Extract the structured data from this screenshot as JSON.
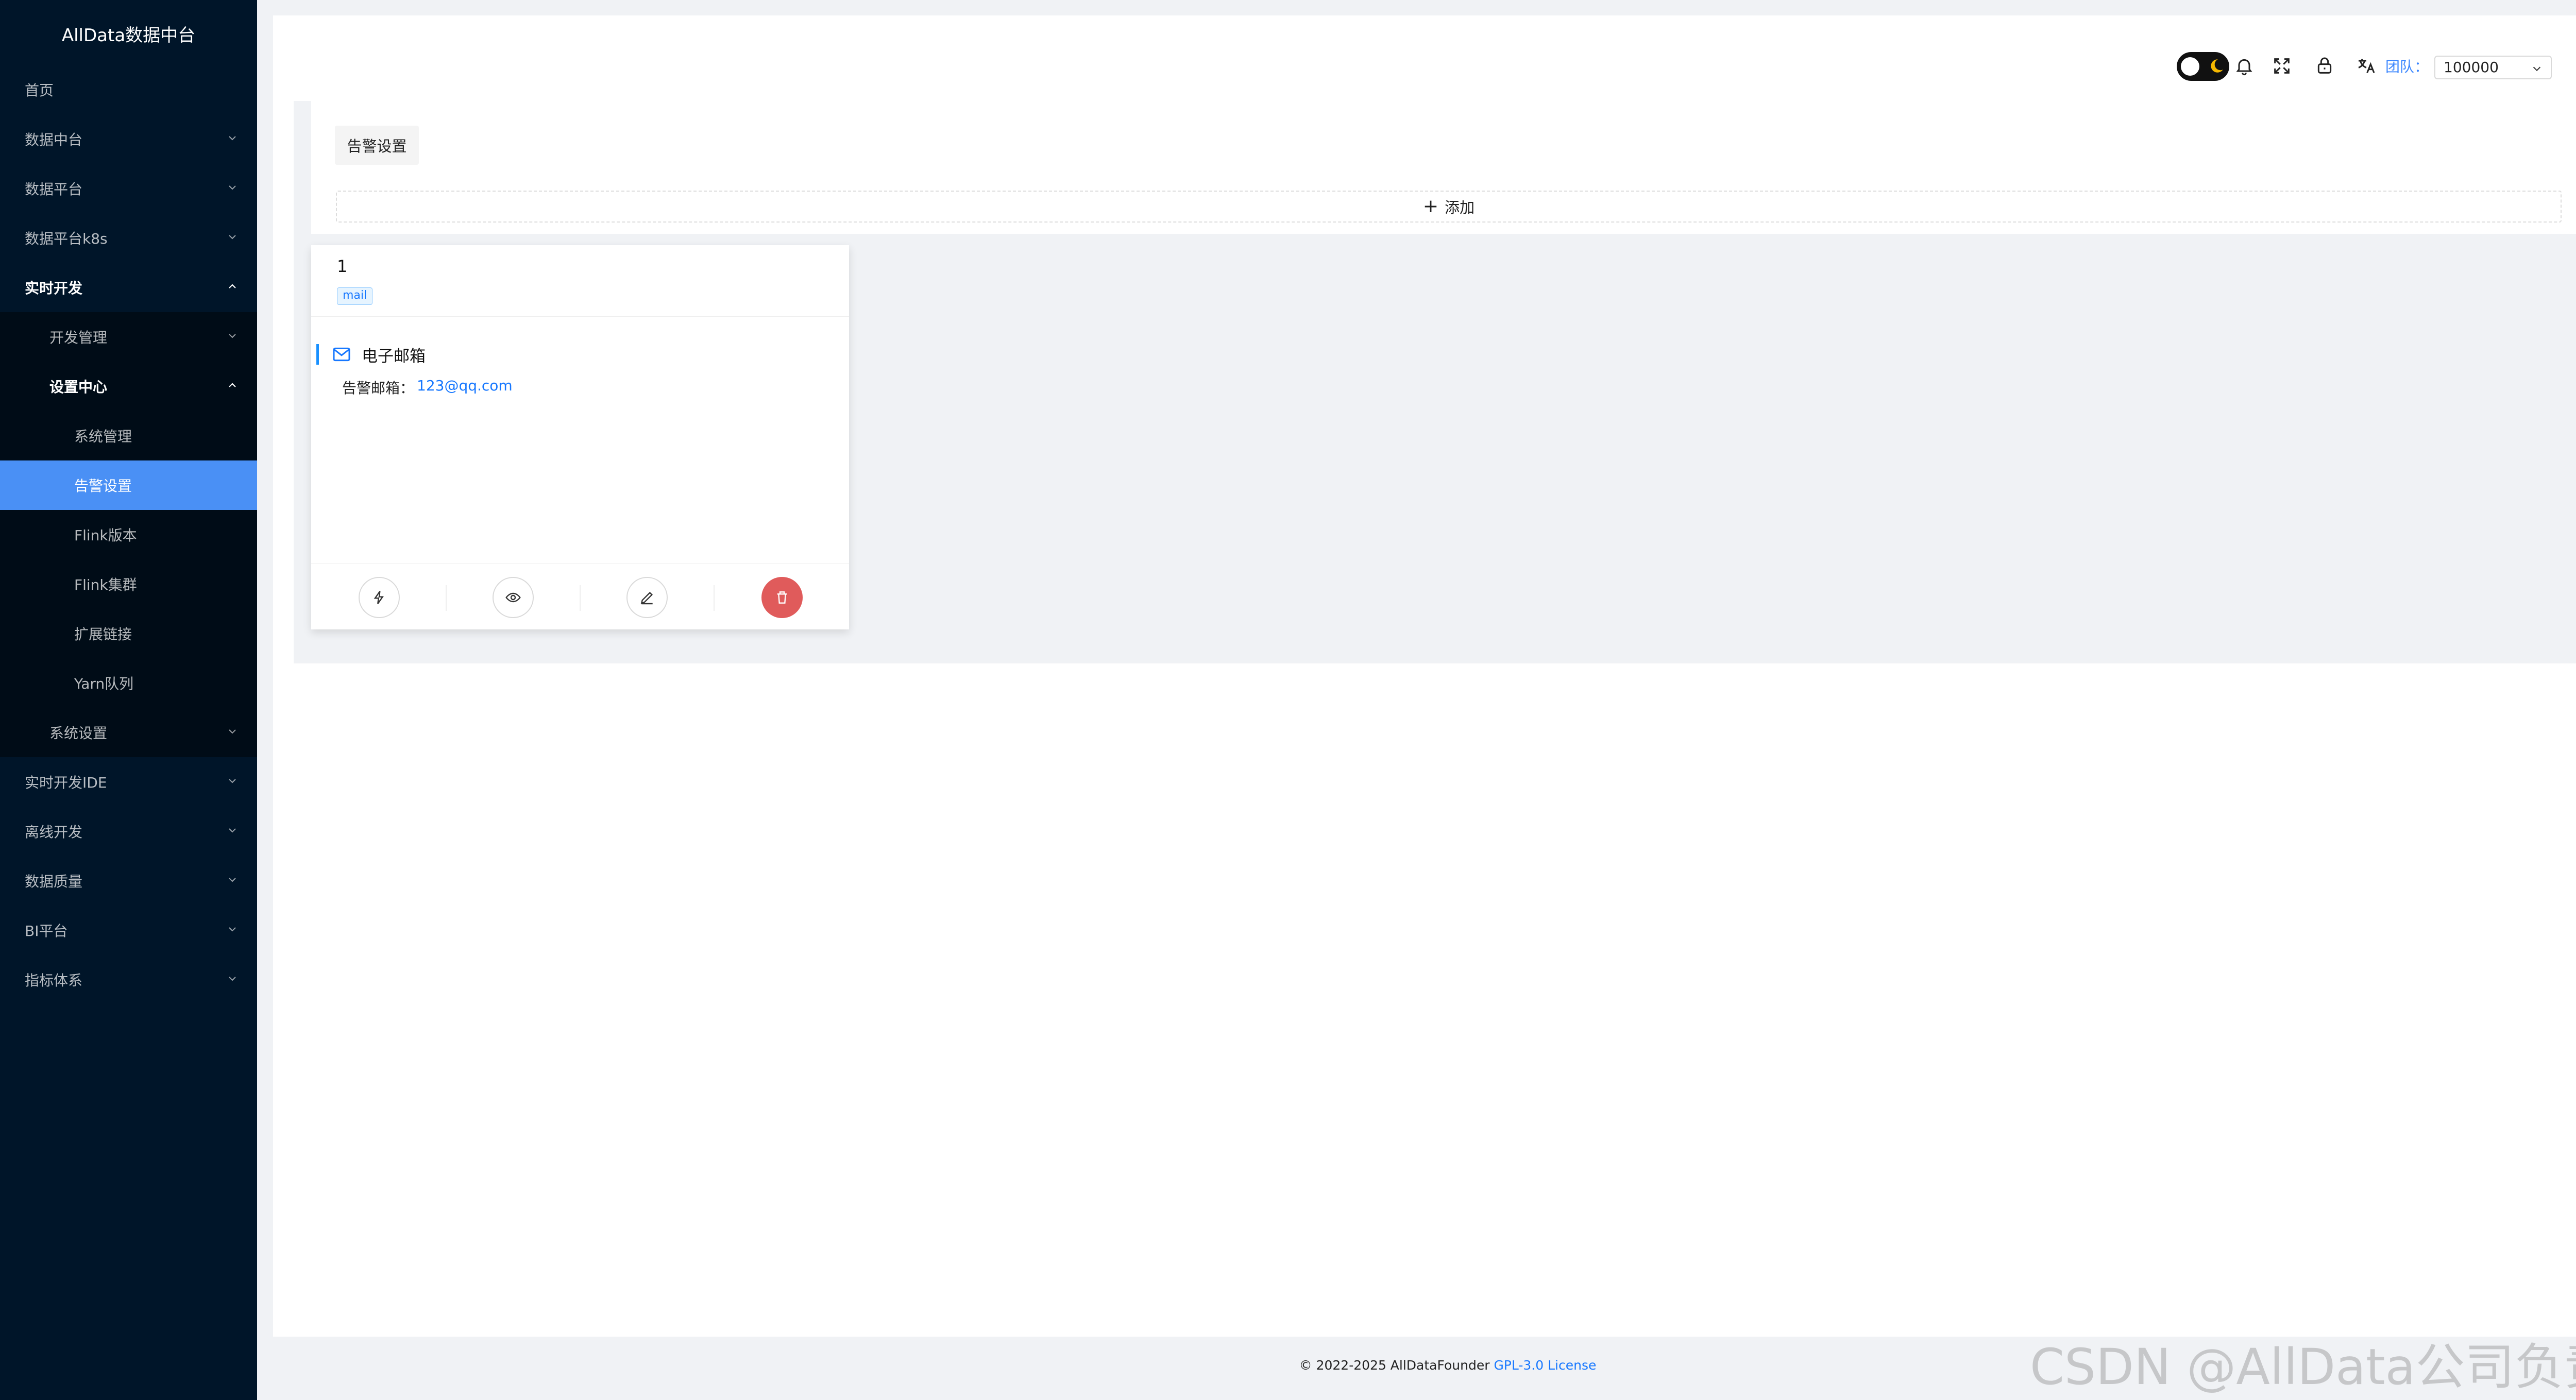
{
  "app": {
    "title": "AllData数据中台"
  },
  "sidebar": {
    "items": [
      {
        "label": "首页",
        "level": 0,
        "expanded": false,
        "has_children": false
      },
      {
        "label": "数据中台",
        "level": 0,
        "expanded": false,
        "has_children": true
      },
      {
        "label": "数据平台",
        "level": 0,
        "expanded": false,
        "has_children": true
      },
      {
        "label": "数据平台k8s",
        "level": 0,
        "expanded": false,
        "has_children": true
      },
      {
        "label": "实时开发",
        "level": 0,
        "expanded": true,
        "has_children": true
      },
      {
        "label": "开发管理",
        "level": 1,
        "expanded": false,
        "has_children": true
      },
      {
        "label": "设置中心",
        "level": 1,
        "expanded": true,
        "has_children": true
      },
      {
        "label": "系统管理",
        "level": 2,
        "has_children": false
      },
      {
        "label": "告警设置",
        "level": 2,
        "has_children": false,
        "active": true
      },
      {
        "label": "Flink版本",
        "level": 2,
        "has_children": false
      },
      {
        "label": "Flink集群",
        "level": 2,
        "has_children": false
      },
      {
        "label": "扩展链接",
        "level": 2,
        "has_children": false
      },
      {
        "label": "Yarn队列",
        "level": 2,
        "has_children": false
      },
      {
        "label": "系统设置",
        "level": 1,
        "expanded": false,
        "has_children": true
      },
      {
        "label": "实时开发IDE",
        "level": 0,
        "expanded": false,
        "has_children": true
      },
      {
        "label": "离线开发",
        "level": 0,
        "expanded": false,
        "has_children": true
      },
      {
        "label": "数据质量",
        "level": 0,
        "expanded": false,
        "has_children": true
      },
      {
        "label": "BI平台",
        "level": 0,
        "expanded": false,
        "has_children": true
      },
      {
        "label": "指标体系",
        "level": 0,
        "expanded": false,
        "has_children": true
      }
    ]
  },
  "header": {
    "theme_toggle": "dark",
    "icons": [
      "bell-icon",
      "fullscreen-icon",
      "lock-icon",
      "translate-icon"
    ],
    "team_label": "团队：",
    "team_value": "100000"
  },
  "page": {
    "tab_label": "告警设置",
    "add_label": "添加"
  },
  "card": {
    "title": "1",
    "tag": "mail",
    "section_title": "电子邮箱",
    "email_label": "告警邮箱：",
    "email_value": "123@qq.com",
    "actions": [
      "test-icon",
      "view-icon",
      "edit-icon",
      "delete-icon"
    ]
  },
  "footer": {
    "text": "© 2022-2025 AllDataFounder ",
    "license": "GPL-3.0 License"
  },
  "watermark": "CSDN @AllData公司负责人",
  "colors": {
    "sidebar_bg": "#001529",
    "submenu_bg": "#000c17",
    "active_item": "#4a90f5",
    "link": "#1677ff",
    "danger": "#e05b5b"
  }
}
